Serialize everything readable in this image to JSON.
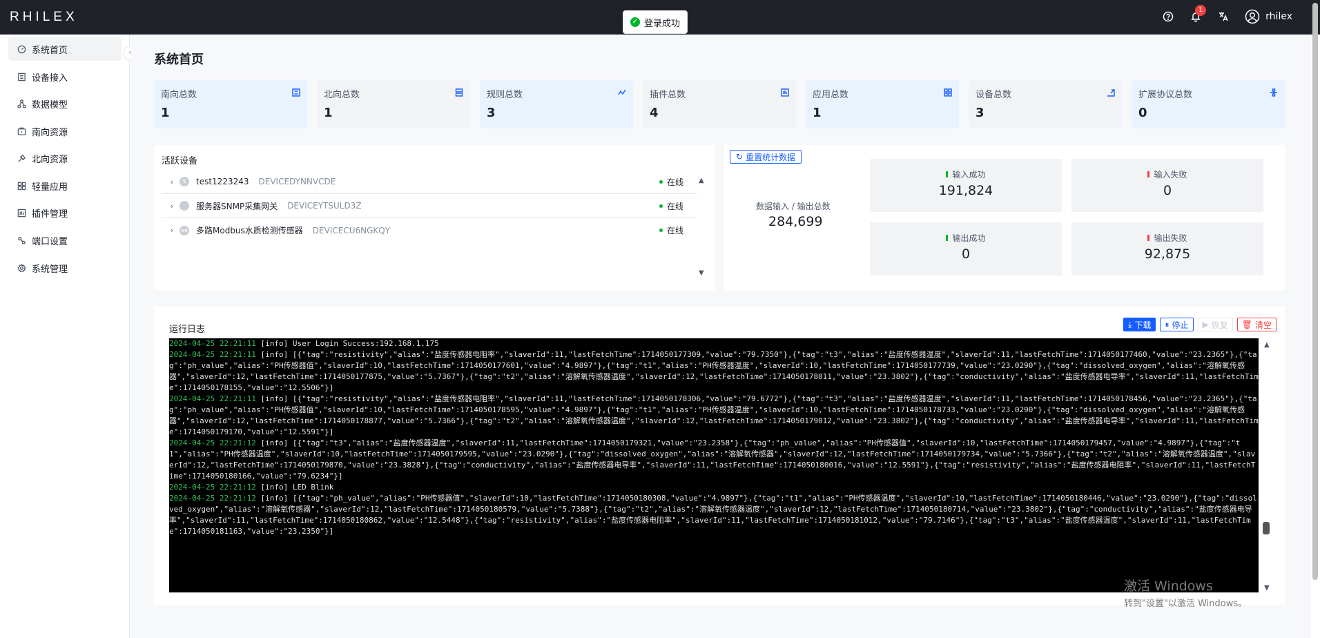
{
  "app": {
    "logo": "RHILEX",
    "username": "rhilex",
    "notification_count": "1"
  },
  "toast": {
    "message": "登录成功"
  },
  "sidebar": {
    "collapse_icon": "chevron-left-icon",
    "items": [
      {
        "label": "系统首页",
        "icon": "dashboard-icon",
        "active": true
      },
      {
        "label": "设备接入",
        "icon": "device-icon"
      },
      {
        "label": "数据模型",
        "icon": "model-icon"
      },
      {
        "label": "南向资源",
        "icon": "inbound-icon"
      },
      {
        "label": "北向资源",
        "icon": "outbound-icon"
      },
      {
        "label": "轻量应用",
        "icon": "app-icon"
      },
      {
        "label": "插件管理",
        "icon": "plugin-icon"
      },
      {
        "label": "端口设置",
        "icon": "port-icon"
      },
      {
        "label": "系统管理",
        "icon": "settings-icon"
      }
    ]
  },
  "page": {
    "title": "系统首页"
  },
  "stats": [
    {
      "label": "南向总数",
      "value": "1",
      "icon": "inbound-icon"
    },
    {
      "label": "北向总数",
      "value": "1",
      "icon": "outbound-icon"
    },
    {
      "label": "规则总数",
      "value": "3",
      "icon": "rule-icon"
    },
    {
      "label": "插件总数",
      "value": "4",
      "icon": "plugin-icon"
    },
    {
      "label": "应用总数",
      "value": "1",
      "icon": "app-icon"
    },
    {
      "label": "设备总数",
      "value": "3",
      "icon": "device-icon"
    },
    {
      "label": "扩展协议总数",
      "value": "0",
      "icon": "protocol-icon"
    }
  ],
  "devices": {
    "title": "活跃设备",
    "rows": [
      {
        "name": "test1223243",
        "uuid": "DEVICEDYNNVCDE",
        "status": "在线",
        "avatar": "S"
      },
      {
        "name": "服务器SNMP采集网关",
        "uuid": "DEVICEYTSULD3Z",
        "status": "在线",
        "avatar": ""
      },
      {
        "name": "多路Modbus水质检测传感器",
        "uuid": "DEVICECU6NGKQY",
        "status": "在线",
        "avatar": "ee"
      }
    ]
  },
  "io": {
    "reset_label": "重置统计数据",
    "total_label": "数据输入 / 输出总数",
    "total_value": "284,699",
    "cards": [
      {
        "label": "输入成功",
        "value": "191,824",
        "color": "#00b42a"
      },
      {
        "label": "输入失败",
        "value": "0",
        "color": "#f53f3f"
      },
      {
        "label": "输出成功",
        "value": "0",
        "color": "#00b42a"
      },
      {
        "label": "输出失败",
        "value": "92,875",
        "color": "#f53f3f"
      }
    ]
  },
  "log": {
    "title": "运行日志",
    "buttons": {
      "download": "下载",
      "stop": "停止",
      "resume": "恢复",
      "clear": "清空"
    },
    "lines": [
      {
        "ts": "2024-04-25 22:21:11",
        "text": " [info] User Login Success:192.168.1.175"
      },
      {
        "ts": "2024-04-25 22:21:11",
        "text": " [info] [{\"tag\":\"resistivity\",\"alias\":\"盐度传感器电阻率\",\"slaverId\":11,\"lastFetchTime\":1714050177309,\"value\":\"79.7350\"},{\"tag\":\"t3\",\"alias\":\"盐度传感器温度\",\"slaverId\":11,\"lastFetchTime\":1714050177460,\"value\":\"23.2365\"},{\"tag\":\"ph_value\",\"alias\":\"PH传感器值\",\"slaverId\":10,\"lastFetchTime\":1714050177601,\"value\":\"4.9897\"},{\"tag\":\"t1\",\"alias\":\"PH传感器温度\",\"slaverId\":10,\"lastFetchTime\":1714050177739,\"value\":\"23.0290\"},{\"tag\":\"dissolved_oxygen\",\"alias\":\"溶解氧传感器\",\"slaverId\":12,\"lastFetchTime\":1714050177875,\"value\":\"5.7367\"},{\"tag\":\"t2\",\"alias\":\"溶解氧传感器温度\",\"slaverId\":12,\"lastFetchTime\":1714050178011,\"value\":\"23.3802\"},{\"tag\":\"conductivity\",\"alias\":\"盐度传感器电导率\",\"slaverId\":11,\"lastFetchTime\":1714050178155,\"value\":\"12.5506\"}]"
      },
      {
        "ts": "2024-04-25 22:21:11",
        "text": " [info] [{\"tag\":\"resistivity\",\"alias\":\"盐度传感器电阻率\",\"slaverId\":11,\"lastFetchTime\":1714050178306,\"value\":\"79.6772\"},{\"tag\":\"t3\",\"alias\":\"盐度传感器温度\",\"slaverId\":11,\"lastFetchTime\":1714050178456,\"value\":\"23.2365\"},{\"tag\":\"ph_value\",\"alias\":\"PH传感器值\",\"slaverId\":10,\"lastFetchTime\":1714050178595,\"value\":\"4.9897\"},{\"tag\":\"t1\",\"alias\":\"PH传感器温度\",\"slaverId\":10,\"lastFetchTime\":1714050178733,\"value\":\"23.0290\"},{\"tag\":\"dissolved_oxygen\",\"alias\":\"溶解氧传感器\",\"slaverId\":12,\"lastFetchTime\":1714050178877,\"value\":\"5.7366\"},{\"tag\":\"t2\",\"alias\":\"溶解氧传感器温度\",\"slaverId\":12,\"lastFetchTime\":1714050179012,\"value\":\"23.3802\"},{\"tag\":\"conductivity\",\"alias\":\"盐度传感器电导率\",\"slaverId\":11,\"lastFetchTime\":1714050179170,\"value\":\"12.5591\"}]"
      },
      {
        "ts": "2024-04-25 22:21:12",
        "text": " [info] [{\"tag\":\"t3\",\"alias\":\"盐度传感器温度\",\"slaverId\":11,\"lastFetchTime\":1714050179321,\"value\":\"23.2358\"},{\"tag\":\"ph_value\",\"alias\":\"PH传感器值\",\"slaverId\":10,\"lastFetchTime\":1714050179457,\"value\":\"4.9897\"},{\"tag\":\"t1\",\"alias\":\"PH传感器温度\",\"slaverId\":10,\"lastFetchTime\":1714050179595,\"value\":\"23.0290\"},{\"tag\":\"dissolved_oxygen\",\"alias\":\"溶解氧传感器\",\"slaverId\":12,\"lastFetchTime\":1714050179734,\"value\":\"5.7366\"},{\"tag\":\"t2\",\"alias\":\"溶解氧传感器温度\",\"slaverId\":12,\"lastFetchTime\":1714050179870,\"value\":\"23.3828\"},{\"tag\":\"conductivity\",\"alias\":\"盐度传感器电导率\",\"slaverId\":11,\"lastFetchTime\":1714050180016,\"value\":\"12.5591\"},{\"tag\":\"resistivity\",\"alias\":\"盐度传感器电阻率\",\"slaverId\":11,\"lastFetchTime\":1714050180166,\"value\":\"79.6234\"}]"
      },
      {
        "ts": "2024-04-25 22:21:12",
        "text": " [info] LED Blink"
      },
      {
        "ts": "2024-04-25 22:21:12",
        "text": " [info] [{\"tag\":\"ph_value\",\"alias\":\"PH传感器值\",\"slaverId\":10,\"lastFetchTime\":1714050180308,\"value\":\"4.9897\"},{\"tag\":\"t1\",\"alias\":\"PH传感器温度\",\"slaverId\":10,\"lastFetchTime\":1714050180446,\"value\":\"23.0290\"},{\"tag\":\"dissolved_oxygen\",\"alias\":\"溶解氧传感器\",\"slaverId\":12,\"lastFetchTime\":1714050180579,\"value\":\"5.7388\"},{\"tag\":\"t2\",\"alias\":\"溶解氧传感器温度\",\"slaverId\":12,\"lastFetchTime\":1714050180714,\"value\":\"23.3802\"},{\"tag\":\"conductivity\",\"alias\":\"盐度传感器电导率\",\"slaverId\":11,\"lastFetchTime\":1714050180862,\"value\":\"12.5448\"},{\"tag\":\"resistivity\",\"alias\":\"盐度传感器电阻率\",\"slaverId\":11,\"lastFetchTime\":1714050181012,\"value\":\"79.7146\"},{\"tag\":\"t3\",\"alias\":\"盐度传感器温度\",\"slaverId\":11,\"lastFetchTime\":1714050181163,\"value\":\"23.2350\"}]"
      }
    ]
  },
  "watermark": {
    "line1": "激活 Windows",
    "line2": "转到\"设置\"以激活 Windows。"
  }
}
